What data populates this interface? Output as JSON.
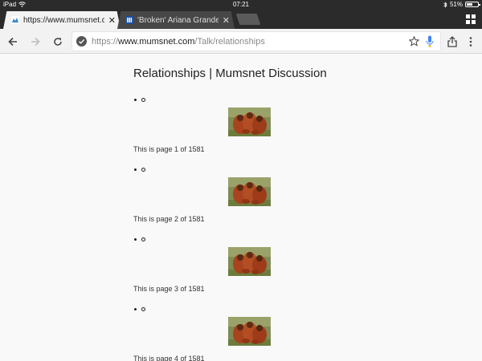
{
  "status_bar": {
    "device": "iPad",
    "time": "07:21",
    "battery": "51%",
    "battery_level": 0.51
  },
  "tabs": [
    {
      "title": "https://www.mumsnet.com/",
      "active": true
    },
    {
      "title": "'Broken' Ariana Grande tweet",
      "active": false
    }
  ],
  "omnibox": {
    "scheme": "https://",
    "host": "www.mumsnet.com",
    "path": "/Talk/relationships"
  },
  "page": {
    "title": "Relationships | Mumsnet Discussion",
    "entries": [
      {
        "page_text": "This is page 1 of 1581",
        "image": "orangutans-thumbnail"
      },
      {
        "page_text": "This is page 2 of 1581",
        "image": "orangutans-thumbnail"
      },
      {
        "page_text": "This is page 3 of 1581",
        "image": "orangutans-thumbnail"
      },
      {
        "page_text": "This is page 4 of 1581",
        "image": "orangutans-thumbnail"
      }
    ]
  },
  "colors": {
    "chrome_dark": "#2b2b2b",
    "toolbar": "#f2f2f2",
    "page_bg": "#f9f9f9",
    "mic_blue": "#4285f4"
  }
}
